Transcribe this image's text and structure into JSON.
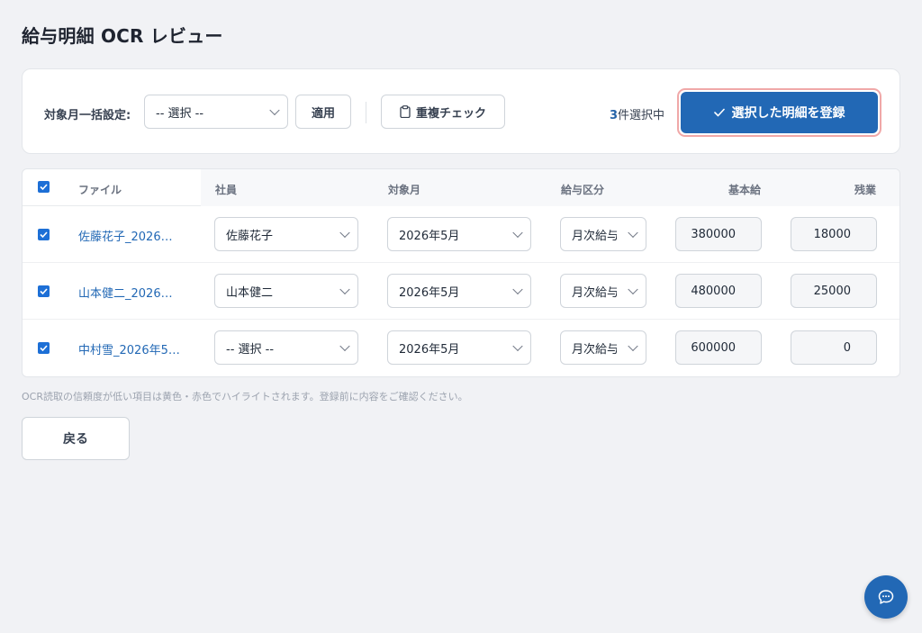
{
  "page": {
    "title": "給与明細 OCR レビュー"
  },
  "toolbar": {
    "bulk_month_label": "対象月一括設定:",
    "bulk_month_select": "-- 選択 --",
    "apply_label": "適用",
    "dup_check_label": "重複チェック",
    "selected_count": "3",
    "selected_suffix": "件選択中",
    "register_label": "選択した明細を登録"
  },
  "table": {
    "headers": {
      "file": "ファイル",
      "employee": "社員",
      "month": "対象月",
      "pay_type": "給与区分",
      "base_pay": "基本給",
      "overtime": "残業"
    },
    "rows": [
      {
        "checked": true,
        "file": "佐藤花子_2026…",
        "employee": "佐藤花子",
        "month": "2026年5月",
        "pay_type": "月次給与",
        "base_pay": "380000",
        "overtime": "18000"
      },
      {
        "checked": true,
        "file": "山本健二_2026…",
        "employee": "山本健二",
        "month": "2026年5月",
        "pay_type": "月次給与",
        "base_pay": "480000",
        "overtime": "25000"
      },
      {
        "checked": true,
        "file": "中村雪_2026年5…",
        "employee": "-- 選択 --",
        "month": "2026年5月",
        "pay_type": "月次給与",
        "base_pay": "600000",
        "overtime": "0"
      }
    ]
  },
  "footer": {
    "note": "OCR読取の信頼度が低い項目は黄色・赤色でハイライトされます。登録前に内容をご確認ください。",
    "back_label": "戻る"
  },
  "icons": {
    "dup_check": "clipboard-icon",
    "register": "check-icon",
    "chat": "chat-bubble-icon",
    "select": "chevron-down-icon"
  },
  "colors": {
    "primary": "#2268b5",
    "link": "#2268b5",
    "focus_ring": "#f0a8a8",
    "background": "#f1f2f5"
  }
}
